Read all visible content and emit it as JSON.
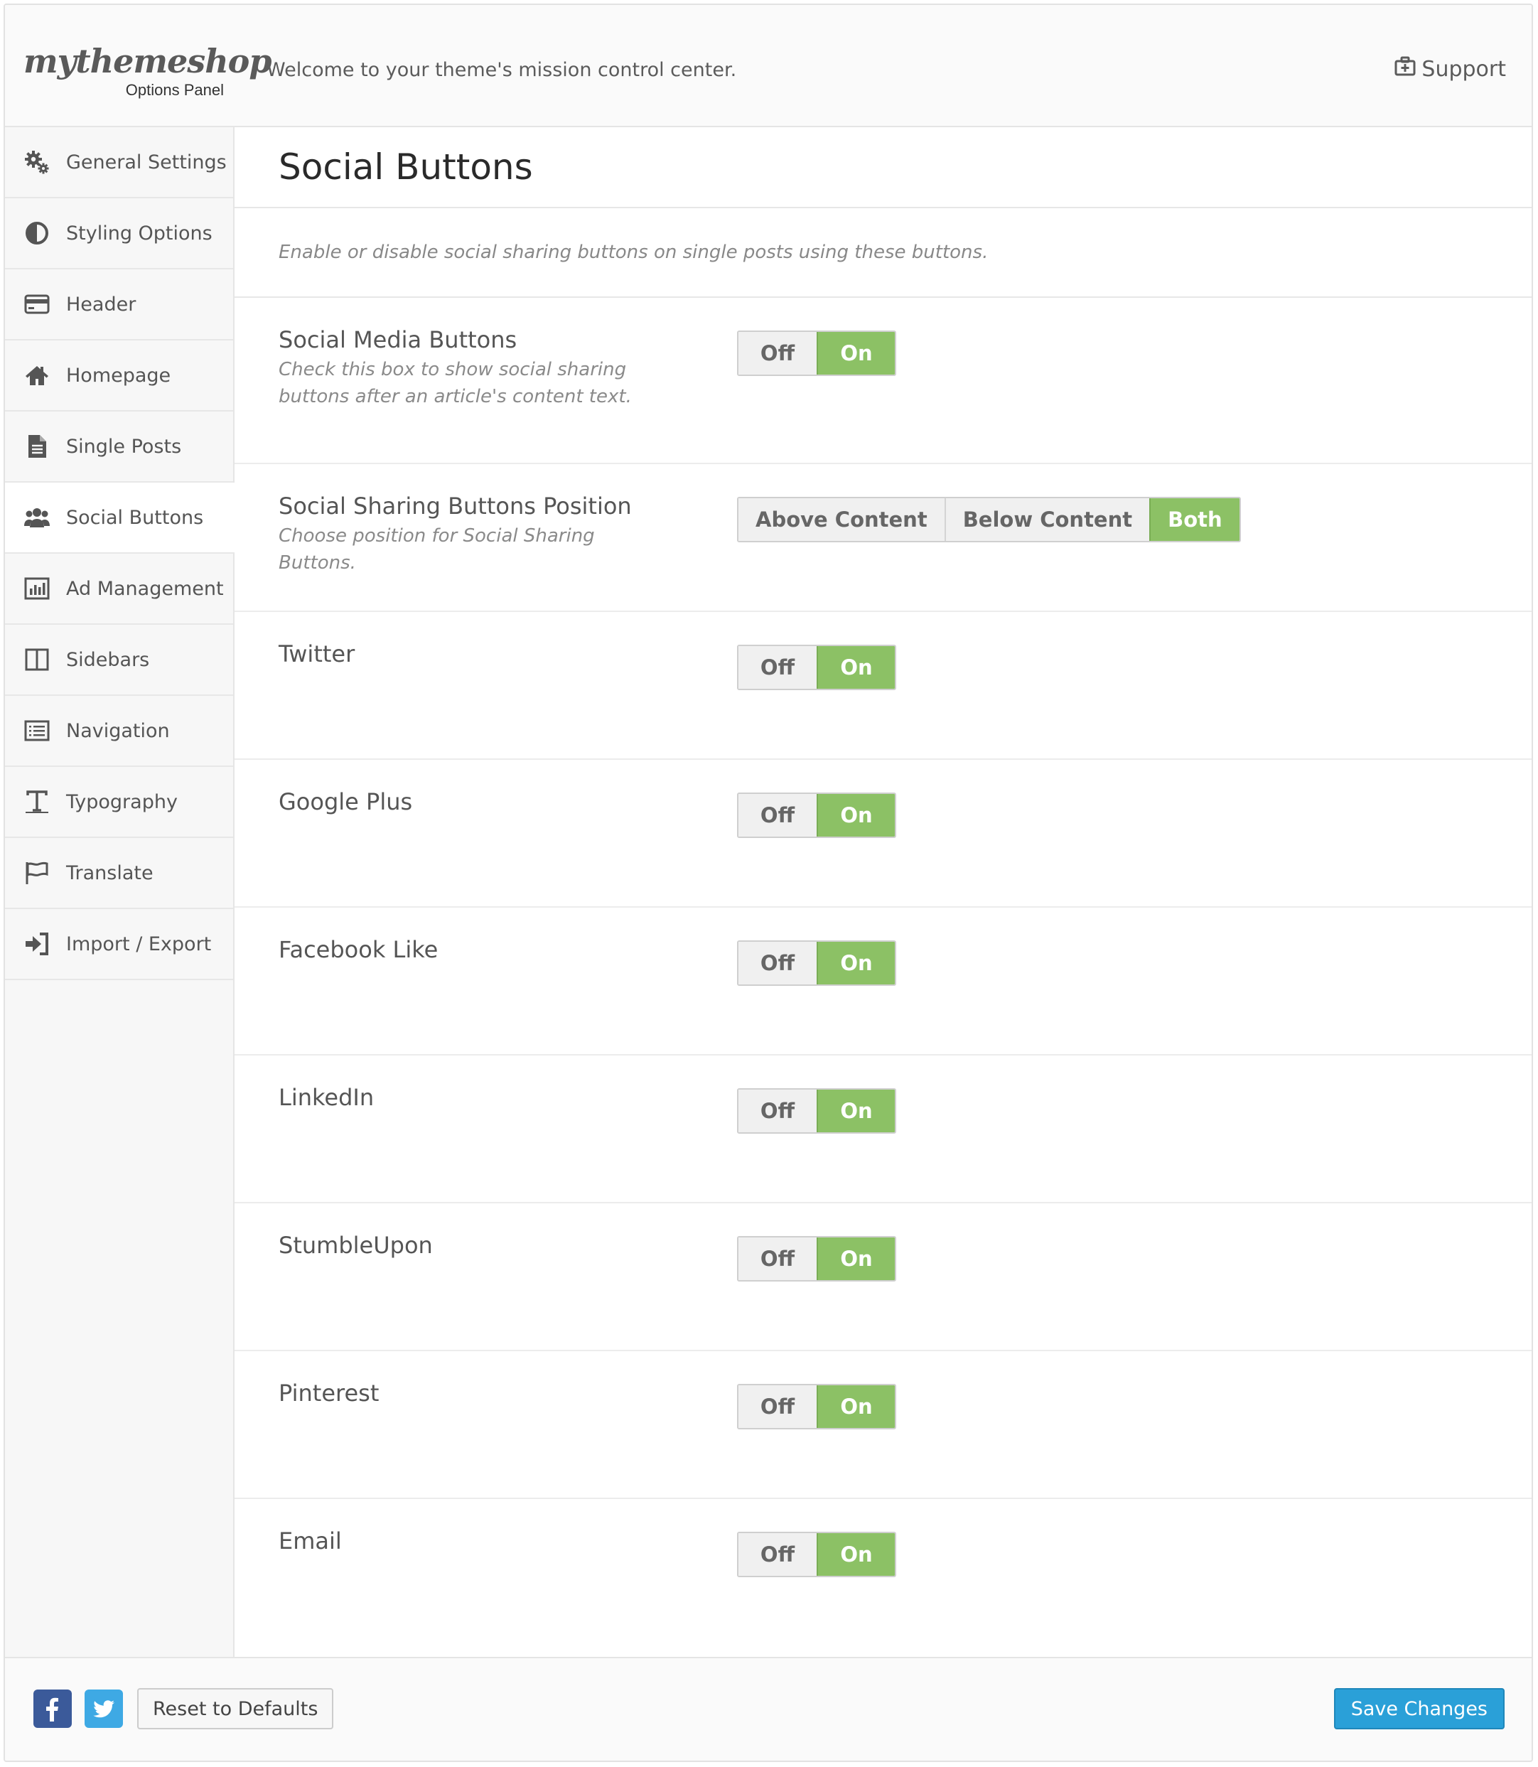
{
  "header": {
    "logo": "mythemeshop",
    "logo_subtitle": "Options Panel",
    "welcome": "Welcome to your theme's mission control center.",
    "support_label": "Support"
  },
  "sidebar": {
    "items": [
      {
        "label": "General Settings",
        "icon": "gears-icon"
      },
      {
        "label": "Styling Options",
        "icon": "contrast-icon"
      },
      {
        "label": "Header",
        "icon": "credit-card-icon"
      },
      {
        "label": "Homepage",
        "icon": "home-icon"
      },
      {
        "label": "Single Posts",
        "icon": "document-icon"
      },
      {
        "label": "Social Buttons",
        "icon": "users-icon",
        "active": true
      },
      {
        "label": "Ad Management",
        "icon": "bar-chart-icon"
      },
      {
        "label": "Sidebars",
        "icon": "columns-icon"
      },
      {
        "label": "Navigation",
        "icon": "list-icon"
      },
      {
        "label": "Typography",
        "icon": "text-icon"
      },
      {
        "label": "Translate",
        "icon": "flag-icon"
      },
      {
        "label": "Import / Export",
        "icon": "sign-in-icon"
      }
    ]
  },
  "main": {
    "title": "Social Buttons",
    "intro": "Enable or disable social sharing buttons on single posts using these buttons.",
    "options": [
      {
        "label": "Social Media Buttons",
        "description": "Check this box to show social sharing buttons after an article's content text.",
        "choices": [
          "Off",
          "On"
        ],
        "selected": "On"
      },
      {
        "label": "Social Sharing Buttons Position",
        "description": "Choose position for Social Sharing Buttons.",
        "choices": [
          "Above Content",
          "Below Content",
          "Both"
        ],
        "selected": "Both"
      },
      {
        "label": "Twitter",
        "choices": [
          "Off",
          "On"
        ],
        "selected": "On"
      },
      {
        "label": "Google Plus",
        "choices": [
          "Off",
          "On"
        ],
        "selected": "On"
      },
      {
        "label": "Facebook Like",
        "choices": [
          "Off",
          "On"
        ],
        "selected": "On"
      },
      {
        "label": "LinkedIn",
        "choices": [
          "Off",
          "On"
        ],
        "selected": "On"
      },
      {
        "label": "StumbleUpon",
        "choices": [
          "Off",
          "On"
        ],
        "selected": "On"
      },
      {
        "label": "Pinterest",
        "choices": [
          "Off",
          "On"
        ],
        "selected": "On"
      },
      {
        "label": "Email",
        "choices": [
          "Off",
          "On"
        ],
        "selected": "On"
      }
    ]
  },
  "footer": {
    "facebook_icon": "facebook-icon",
    "twitter_icon": "twitter-icon",
    "reset_label": "Reset to Defaults",
    "save_label": "Save Changes"
  },
  "colors": {
    "toggle_on": "#8cc165",
    "save_button": "#2aa0d8",
    "facebook": "#3b5a9a",
    "twitter": "#3ea9e4"
  }
}
